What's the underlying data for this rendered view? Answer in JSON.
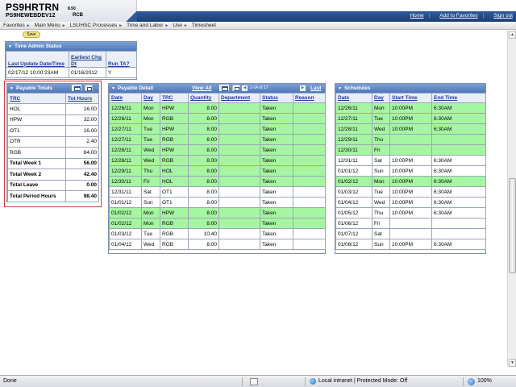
{
  "header": {
    "db_name": "PS9HRTRN",
    "db_version": "8.50",
    "server_name": "PS9HEWEBDEV12",
    "user_id": "RCB",
    "links": [
      "Home",
      "Add to Favorites",
      "Sign out"
    ]
  },
  "breadcrumb": [
    "Favorites",
    "Main Menu",
    "LSUHSC Processes",
    "Time and Labor",
    "Use",
    "Timesheet"
  ],
  "save_label": "Save",
  "time_admin_status": {
    "title": "Time Admin Status",
    "columns": [
      "Last Update Date/Time",
      "Earliest Chg Dt",
      "Run TA?"
    ],
    "row": [
      "02/17/12 10:00:23AM",
      "01/16/2012",
      "Y"
    ]
  },
  "payable_totals": {
    "title": "Payable Totals",
    "columns": [
      "TRC",
      "Tot Hours"
    ],
    "rows": [
      {
        "trc": "HOL",
        "hours": "16.00",
        "bold": false
      },
      {
        "trc": "HPW",
        "hours": "32.00",
        "bold": false
      },
      {
        "trc": "OT1",
        "hours": "16.00",
        "bold": false
      },
      {
        "trc": "OTR",
        "hours": "2.40",
        "bold": false
      },
      {
        "trc": "RGB",
        "hours": "64.00",
        "bold": false
      },
      {
        "trc": "Total Week 1",
        "hours": "56.00",
        "bold": true
      },
      {
        "trc": "Total Week 2",
        "hours": "42.40",
        "bold": true
      },
      {
        "trc": "Total Leave",
        "hours": "0.00",
        "bold": true
      },
      {
        "trc": "Total Period Hours",
        "hours": "98.40",
        "bold": true
      }
    ]
  },
  "payable_detail": {
    "title": "Payable Detail",
    "view_all": "View All",
    "range": "1-14 of 17",
    "last": "Last",
    "columns": [
      "Date",
      "Day",
      "TRC",
      "Quantity",
      "Department",
      "Status",
      "Reason"
    ],
    "rows": [
      {
        "date": "12/26/11",
        "day": "Mon",
        "trc": "HPW",
        "qty": "8.00",
        "dept": "",
        "status": "Taken",
        "reason": "",
        "green": true
      },
      {
        "date": "12/26/11",
        "day": "Mon",
        "trc": "RGB",
        "qty": "8.00",
        "dept": "",
        "status": "Taken",
        "reason": "",
        "green": true
      },
      {
        "date": "12/27/11",
        "day": "Tue",
        "trc": "HPW",
        "qty": "8.00",
        "dept": "",
        "status": "Taken",
        "reason": "",
        "green": true
      },
      {
        "date": "12/27/11",
        "day": "Tue",
        "trc": "RGB",
        "qty": "8.00",
        "dept": "",
        "status": "Taken",
        "reason": "",
        "green": true
      },
      {
        "date": "12/28/11",
        "day": "Wed",
        "trc": "HPW",
        "qty": "8.00",
        "dept": "",
        "status": "Taken",
        "reason": "",
        "green": true
      },
      {
        "date": "12/28/11",
        "day": "Wed",
        "trc": "RGB",
        "qty": "8.00",
        "dept": "",
        "status": "Taken",
        "reason": "",
        "green": true
      },
      {
        "date": "12/29/11",
        "day": "Thu",
        "trc": "HOL",
        "qty": "8.00",
        "dept": "",
        "status": "Taken",
        "reason": "",
        "green": true
      },
      {
        "date": "12/30/11",
        "day": "Fri",
        "trc": "HOL",
        "qty": "8.00",
        "dept": "",
        "status": "Taken",
        "reason": "",
        "green": true
      },
      {
        "date": "12/31/11",
        "day": "Sat",
        "trc": "OT1",
        "qty": "8.00",
        "dept": "",
        "status": "Taken",
        "reason": "",
        "green": false
      },
      {
        "date": "01/01/12",
        "day": "Sun",
        "trc": "OT1",
        "qty": "8.00",
        "dept": "",
        "status": "Taken",
        "reason": "",
        "green": false
      },
      {
        "date": "01/02/12",
        "day": "Mon",
        "trc": "HPW",
        "qty": "8.00",
        "dept": "",
        "status": "Taken",
        "reason": "",
        "green": true
      },
      {
        "date": "01/02/12",
        "day": "Mon",
        "trc": "RGB",
        "qty": "8.00",
        "dept": "",
        "status": "Taken",
        "reason": "",
        "green": true
      },
      {
        "date": "01/03/12",
        "day": "Tue",
        "trc": "RGB",
        "qty": "10.40",
        "dept": "",
        "status": "Taken",
        "reason": "",
        "green": false
      },
      {
        "date": "01/04/12",
        "day": "Wed",
        "trc": "RGB",
        "qty": "8.00",
        "dept": "",
        "status": "Taken",
        "reason": "",
        "green": false
      }
    ]
  },
  "schedules": {
    "title": "Schedules",
    "columns": [
      "Date",
      "Day",
      "Start Time",
      "End Time"
    ],
    "rows": [
      {
        "date": "12/26/11",
        "day": "Mon",
        "start": "10:00PM",
        "end": "6:30AM",
        "green": true
      },
      {
        "date": "12/27/11",
        "day": "Tue",
        "start": "10:00PM",
        "end": "6:30AM",
        "green": true
      },
      {
        "date": "12/28/11",
        "day": "Wed",
        "start": "10:00PM",
        "end": "6:30AM",
        "green": true
      },
      {
        "date": "12/29/11",
        "day": "Thu",
        "start": "",
        "end": "",
        "green": true
      },
      {
        "date": "12/30/11",
        "day": "Fri",
        "start": "",
        "end": "",
        "green": true
      },
      {
        "date": "12/31/11",
        "day": "Sat",
        "start": "10:00PM",
        "end": "6:30AM",
        "green": false
      },
      {
        "date": "01/01/12",
        "day": "Sun",
        "start": "10:00PM",
        "end": "6:30AM",
        "green": false
      },
      {
        "date": "01/02/12",
        "day": "Mon",
        "start": "10:00PM",
        "end": "6:30AM",
        "green": true
      },
      {
        "date": "01/03/12",
        "day": "Tue",
        "start": "10:00PM",
        "end": "6:30AM",
        "green": false
      },
      {
        "date": "01/04/12",
        "day": "Wed",
        "start": "10:00PM",
        "end": "6:30AM",
        "green": false
      },
      {
        "date": "01/05/12",
        "day": "Thu",
        "start": "10:00PM",
        "end": "6:30AM",
        "green": false
      },
      {
        "date": "01/06/12",
        "day": "Fri",
        "start": "",
        "end": "",
        "green": false
      },
      {
        "date": "01/07/12",
        "day": "Sat",
        "start": "",
        "end": "",
        "green": false
      },
      {
        "date": "01/08/12",
        "day": "Sun",
        "start": "10:00PM",
        "end": "6:30AM",
        "green": false
      }
    ]
  },
  "statusbar": {
    "status": "Done",
    "zone": "Local intranet | Protected Mode: Off",
    "zoom": "100%"
  },
  "colors": {
    "taken_row": "#a6f5a2",
    "panel_header": "#4d77b9",
    "highlight_border": "#d03a3a"
  }
}
